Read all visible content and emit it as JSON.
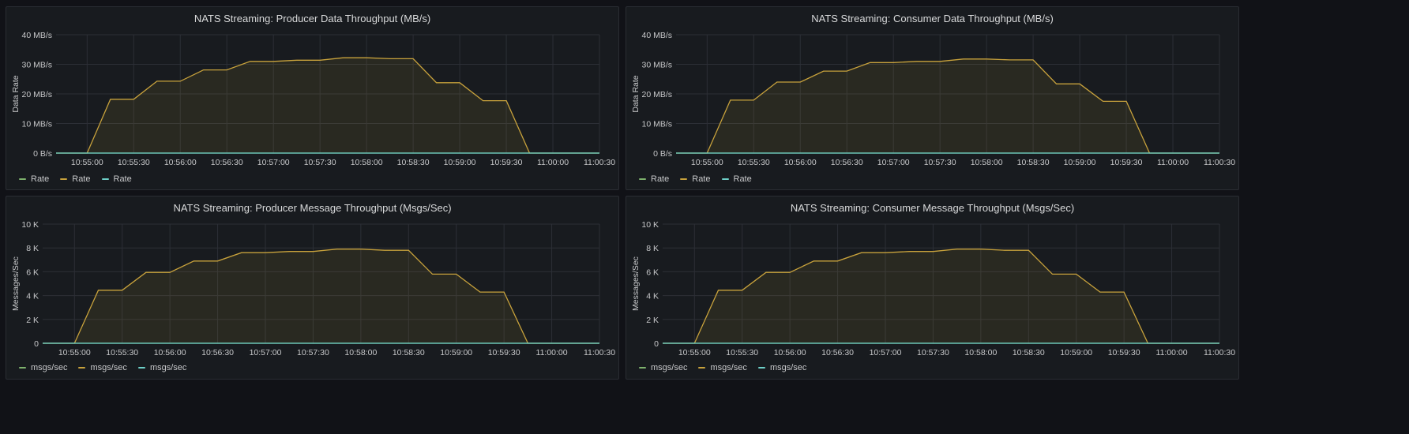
{
  "panels": [
    {
      "title": "NATS Streaming: Producer Data Throughput (MB/s)",
      "legend": [
        "Rate",
        "Rate",
        "Rate"
      ]
    },
    {
      "title": "NATS Streaming: Consumer Data Throughput (MB/s)",
      "legend": [
        "Rate",
        "Rate",
        "Rate"
      ]
    },
    {
      "title": "NATS Streaming: Producer Message Throughput (Msgs/Sec)",
      "legend": [
        "msgs/sec",
        "msgs/sec",
        "msgs/sec"
      ]
    },
    {
      "title": "NATS Streaming: Consumer Message Throughput (Msgs/Sec)",
      "legend": [
        "msgs/sec",
        "msgs/sec",
        "msgs/sec"
      ]
    }
  ],
  "colors": {
    "series": [
      "#7eb26d",
      "#c8a23c",
      "#6ed0c8"
    ],
    "fill": "#c8a23c",
    "grid": "#2c2f36"
  },
  "chart_data": [
    {
      "type": "line",
      "title": "NATS Streaming: Producer Data Throughput (MB/s)",
      "ylabel": "Data Rate",
      "xlabel": "",
      "x": [
        "10:54:40",
        "10:55:00",
        "10:55:15",
        "10:55:30",
        "10:55:45",
        "10:56:00",
        "10:56:15",
        "10:56:30",
        "10:56:45",
        "10:57:00",
        "10:57:15",
        "10:57:30",
        "10:57:45",
        "10:58:00",
        "10:58:15",
        "10:58:30",
        "10:58:45",
        "10:59:00",
        "10:59:15",
        "10:59:30",
        "10:59:45",
        "11:00:00",
        "11:00:15",
        "11:00:30"
      ],
      "x_ticks": [
        "10:55:00",
        "10:55:30",
        "10:56:00",
        "10:56:30",
        "10:57:00",
        "10:57:30",
        "10:58:00",
        "10:58:30",
        "10:59:00",
        "10:59:30",
        "11:00:00",
        "11:00:30"
      ],
      "y_ticks": [
        "0 B/s",
        "10 MB/s",
        "20 MB/s",
        "30 MB/s",
        "40 MB/s"
      ],
      "ylim": [
        0,
        40
      ],
      "series": [
        {
          "values": [
            0,
            0,
            0,
            0,
            0,
            0,
            0,
            0,
            0,
            0,
            0,
            0,
            0,
            0,
            0,
            0,
            0,
            0,
            0,
            0,
            0,
            0,
            0,
            0
          ]
        },
        {
          "values": [
            0,
            0,
            18.2,
            18.2,
            24.3,
            24.3,
            28.1,
            28.1,
            31.0,
            31.0,
            31.4,
            31.4,
            32.2,
            32.2,
            31.9,
            31.9,
            23.8,
            23.8,
            17.7,
            17.7,
            0,
            0,
            0,
            0
          ]
        },
        {
          "values": [
            0,
            0,
            0,
            0,
            0,
            0,
            0,
            0,
            0,
            0,
            0,
            0,
            0,
            0,
            0,
            0,
            0,
            0,
            0,
            0,
            0,
            0,
            0,
            0
          ]
        }
      ],
      "grid": true,
      "legend_position": "bottom-left"
    },
    {
      "type": "line",
      "title": "NATS Streaming: Consumer Data Throughput (MB/s)",
      "ylabel": "Data Rate",
      "xlabel": "",
      "x": [
        "10:54:40",
        "10:55:00",
        "10:55:15",
        "10:55:30",
        "10:55:45",
        "10:56:00",
        "10:56:15",
        "10:56:30",
        "10:56:45",
        "10:57:00",
        "10:57:15",
        "10:57:30",
        "10:57:45",
        "10:58:00",
        "10:58:15",
        "10:58:30",
        "10:58:45",
        "10:59:00",
        "10:59:15",
        "10:59:30",
        "10:59:45",
        "11:00:00",
        "11:00:15",
        "11:00:30"
      ],
      "x_ticks": [
        "10:55:00",
        "10:55:30",
        "10:56:00",
        "10:56:30",
        "10:57:00",
        "10:57:30",
        "10:58:00",
        "10:58:30",
        "10:59:00",
        "10:59:30",
        "11:00:00",
        "11:00:30"
      ],
      "y_ticks": [
        "0 B/s",
        "10 MB/s",
        "20 MB/s",
        "30 MB/s",
        "40 MB/s"
      ],
      "ylim": [
        0,
        40
      ],
      "series": [
        {
          "values": [
            0,
            0,
            0,
            0,
            0,
            0,
            0,
            0,
            0,
            0,
            0,
            0,
            0,
            0,
            0,
            0,
            0,
            0,
            0,
            0,
            0,
            0,
            0,
            0
          ]
        },
        {
          "values": [
            0,
            0,
            17.9,
            17.9,
            24.0,
            24.0,
            27.7,
            27.7,
            30.6,
            30.6,
            31.0,
            31.0,
            31.8,
            31.8,
            31.5,
            31.5,
            23.4,
            23.4,
            17.5,
            17.5,
            0,
            0,
            0,
            0
          ]
        },
        {
          "values": [
            0,
            0,
            0,
            0,
            0,
            0,
            0,
            0,
            0,
            0,
            0,
            0,
            0,
            0,
            0,
            0,
            0,
            0,
            0,
            0,
            0,
            0,
            0,
            0
          ]
        }
      ],
      "grid": true,
      "legend_position": "bottom-left"
    },
    {
      "type": "line",
      "title": "NATS Streaming: Producer Message Throughput (Msgs/Sec)",
      "ylabel": "Messages/Sec",
      "xlabel": "",
      "x": [
        "10:54:40",
        "10:55:00",
        "10:55:15",
        "10:55:30",
        "10:55:45",
        "10:56:00",
        "10:56:15",
        "10:56:30",
        "10:56:45",
        "10:57:00",
        "10:57:15",
        "10:57:30",
        "10:57:45",
        "10:58:00",
        "10:58:15",
        "10:58:30",
        "10:58:45",
        "10:59:00",
        "10:59:15",
        "10:59:30",
        "10:59:45",
        "11:00:00",
        "11:00:15",
        "11:00:30"
      ],
      "x_ticks": [
        "10:55:00",
        "10:55:30",
        "10:56:00",
        "10:56:30",
        "10:57:00",
        "10:57:30",
        "10:58:00",
        "10:58:30",
        "10:59:00",
        "10:59:30",
        "11:00:00",
        "11:00:30"
      ],
      "y_ticks": [
        "0",
        "2 K",
        "4 K",
        "6 K",
        "8 K",
        "10 K"
      ],
      "ylim": [
        0,
        10000
      ],
      "series": [
        {
          "values": [
            0,
            0,
            0,
            0,
            0,
            0,
            0,
            0,
            0,
            0,
            0,
            0,
            0,
            0,
            0,
            0,
            0,
            0,
            0,
            0,
            0,
            0,
            0,
            0
          ]
        },
        {
          "values": [
            0,
            0,
            4450,
            4450,
            5950,
            5950,
            6900,
            6900,
            7600,
            7600,
            7700,
            7700,
            7900,
            7900,
            7800,
            7800,
            5800,
            5800,
            4300,
            4300,
            0,
            0,
            0,
            0
          ]
        },
        {
          "values": [
            0,
            0,
            0,
            0,
            0,
            0,
            0,
            0,
            0,
            0,
            0,
            0,
            0,
            0,
            0,
            0,
            0,
            0,
            0,
            0,
            0,
            0,
            0,
            0
          ]
        }
      ],
      "grid": true,
      "legend_position": "bottom-left"
    },
    {
      "type": "line",
      "title": "NATS Streaming: Consumer Message Throughput (Msgs/Sec)",
      "ylabel": "Messages/Sec",
      "xlabel": "",
      "x": [
        "10:54:40",
        "10:55:00",
        "10:55:15",
        "10:55:30",
        "10:55:45",
        "10:56:00",
        "10:56:15",
        "10:56:30",
        "10:56:45",
        "10:57:00",
        "10:57:15",
        "10:57:30",
        "10:57:45",
        "10:58:00",
        "10:58:15",
        "10:58:30",
        "10:58:45",
        "10:59:00",
        "10:59:15",
        "10:59:30",
        "10:59:45",
        "11:00:00",
        "11:00:15",
        "11:00:30"
      ],
      "x_ticks": [
        "10:55:00",
        "10:55:30",
        "10:56:00",
        "10:56:30",
        "10:57:00",
        "10:57:30",
        "10:58:00",
        "10:58:30",
        "10:59:00",
        "10:59:30",
        "11:00:00",
        "11:00:30"
      ],
      "y_ticks": [
        "0",
        "2 K",
        "4 K",
        "6 K",
        "8 K",
        "10 K"
      ],
      "ylim": [
        0,
        10000
      ],
      "series": [
        {
          "values": [
            0,
            0,
            0,
            0,
            0,
            0,
            0,
            0,
            0,
            0,
            0,
            0,
            0,
            0,
            0,
            0,
            0,
            0,
            0,
            0,
            0,
            0,
            0,
            0
          ]
        },
        {
          "values": [
            0,
            0,
            4450,
            4450,
            5950,
            5950,
            6900,
            6900,
            7600,
            7600,
            7700,
            7700,
            7900,
            7900,
            7800,
            7800,
            5800,
            5800,
            4300,
            4300,
            0,
            0,
            0,
            0
          ]
        },
        {
          "values": [
            0,
            0,
            0,
            0,
            0,
            0,
            0,
            0,
            0,
            0,
            0,
            0,
            0,
            0,
            0,
            0,
            0,
            0,
            0,
            0,
            0,
            0,
            0,
            0
          ]
        }
      ],
      "grid": true,
      "legend_position": "bottom-left"
    }
  ]
}
